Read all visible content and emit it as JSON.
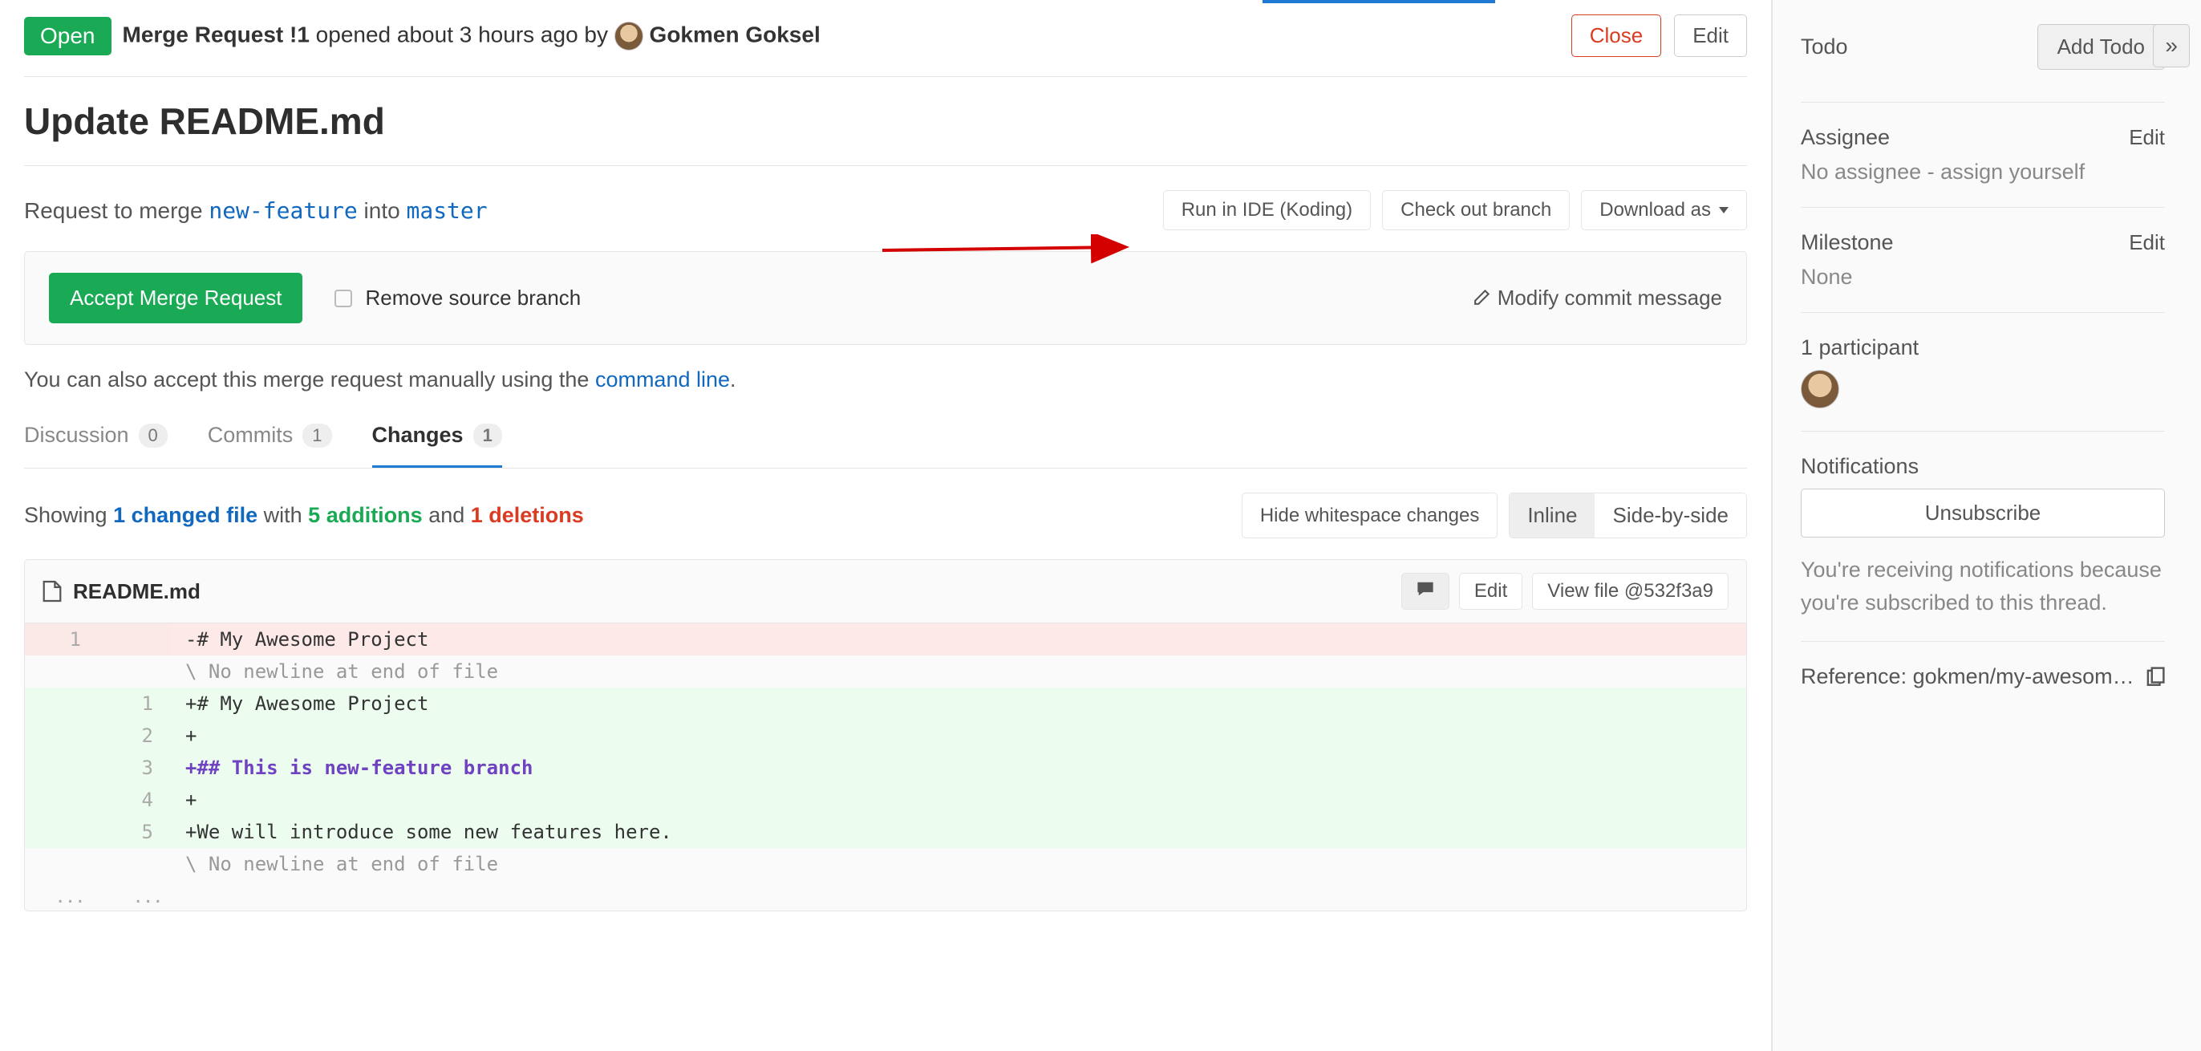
{
  "header": {
    "badge": "Open",
    "mr_label": "Merge Request !1",
    "opened_text": " opened about 3 hours ago by ",
    "author": "Gokmen Goksel",
    "close": "Close",
    "edit": "Edit"
  },
  "title": "Update README.md",
  "merge": {
    "prefix": "Request to merge ",
    "source": "new-feature",
    "into": " into ",
    "target": "master",
    "run_ide": "Run in IDE (Koding)",
    "checkout": "Check out branch",
    "download": "Download as"
  },
  "accept": {
    "accept_btn": "Accept Merge Request",
    "remove_branch": "Remove source branch",
    "modify": "Modify commit message"
  },
  "cmd_hint": {
    "text": "You can also accept this merge request manually using the ",
    "link": "command line",
    "suffix": "."
  },
  "tabs": {
    "discussion": "Discussion",
    "discussion_count": "0",
    "commits": "Commits",
    "commits_count": "1",
    "changes": "Changes",
    "changes_count": "1"
  },
  "diff_stats": {
    "showing": "Showing ",
    "files": "1 changed file",
    "with": " with ",
    "adds": "5 additions",
    "and": " and ",
    "dels": "1 deletions",
    "hide_ws": "Hide whitespace changes",
    "inline": "Inline",
    "side": "Side-by-side"
  },
  "file": {
    "name": "README.md",
    "edit": "Edit",
    "view": "View file @532f3a9"
  },
  "diff_lines": [
    {
      "old": "1",
      "new": "",
      "type": "del",
      "text": "-# My Awesome Project"
    },
    {
      "old": "",
      "new": "",
      "type": "ctx",
      "text": "\\ No newline at end of file"
    },
    {
      "old": "",
      "new": "1",
      "type": "add",
      "text": "+# My Awesome Project"
    },
    {
      "old": "",
      "new": "2",
      "type": "add",
      "text": "+"
    },
    {
      "old": "",
      "new": "3",
      "type": "add",
      "heading": true,
      "text": "+## This is new-feature branch"
    },
    {
      "old": "",
      "new": "4",
      "type": "add",
      "text": "+"
    },
    {
      "old": "",
      "new": "5",
      "type": "add",
      "text": "+We will introduce some new features here."
    },
    {
      "old": "",
      "new": "",
      "type": "ctx",
      "text": "\\ No newline at end of file"
    }
  ],
  "sidebar": {
    "todo_label": "Todo",
    "add_todo": "Add Todo",
    "assignee_label": "Assignee",
    "assignee_value": "No assignee - assign yourself",
    "milestone_label": "Milestone",
    "milestone_value": "None",
    "participants": "1 participant",
    "notifications_label": "Notifications",
    "unsubscribe": "Unsubscribe",
    "notif_text": "You're receiving notifications because you're subscribed to this thread.",
    "reference": "Reference: gokmen/my-awesom…",
    "edit": "Edit"
  }
}
